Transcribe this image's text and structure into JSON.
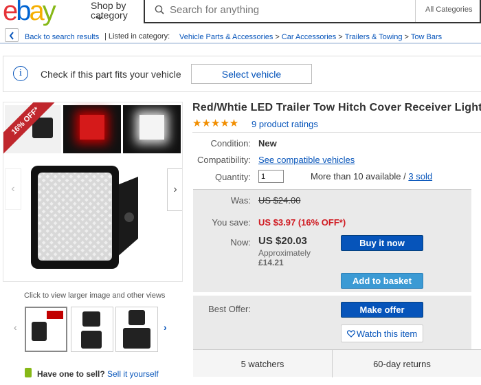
{
  "header": {
    "logo_letters": [
      "e",
      "b",
      "a",
      "y"
    ],
    "shop_by_line1": "Shop by",
    "shop_by_line2": "category",
    "search_placeholder": "Search for anything",
    "category_select": "All Categories"
  },
  "breadcrumb": {
    "back": "Back to search results",
    "listed": "| Listed in category:",
    "path": [
      "Vehicle Parts & Accessories",
      "Car Accessories",
      "Trailers & Towing",
      "Tow Bars"
    ],
    "separator": ">"
  },
  "compatibility": {
    "info_glyph": "i",
    "text": "Check if this part fits your vehicle",
    "button": "Select vehicle"
  },
  "gallery": {
    "discount_ribbon": "16% OFF*",
    "click_hint": "Click to view larger image and other views",
    "arrow_left": "‹",
    "arrow_right": "›"
  },
  "sell": {
    "question": "Have one to sell?",
    "link": "Sell it yourself"
  },
  "product": {
    "title": "Red/Whtie LED Trailer Tow Hitch Cover Receiver Light w/",
    "stars": "★★★★★",
    "rating_value": 4.5,
    "ratings_link": "9 product ratings",
    "condition_label": "Condition:",
    "condition_value": "New",
    "compat_label": "Compatibility:",
    "compat_link": "See compatible vehicles",
    "quantity_label": "Quantity:",
    "quantity_value": "1",
    "available_text": "More than 10 available /",
    "sold_link": "3 sold"
  },
  "pricing": {
    "was_label": "Was:",
    "was_value": "US $24.00",
    "save_label": "You save:",
    "save_value": "US $3.97 (16% OFF*)",
    "now_label": "Now:",
    "now_value": "US $20.03",
    "approx_label": "Approximately",
    "approx_value": "£14.21",
    "buy_now": "Buy it now",
    "add_basket": "Add to basket",
    "best_offer_label": "Best Offer:",
    "make_offer": "Make offer",
    "watch": "Watch this item"
  },
  "footer": {
    "watchers": "5 watchers",
    "returns": "60-day returns"
  },
  "colors": {
    "link": "#0654ba",
    "price_red": "#d01b22",
    "star": "#f18e00"
  }
}
